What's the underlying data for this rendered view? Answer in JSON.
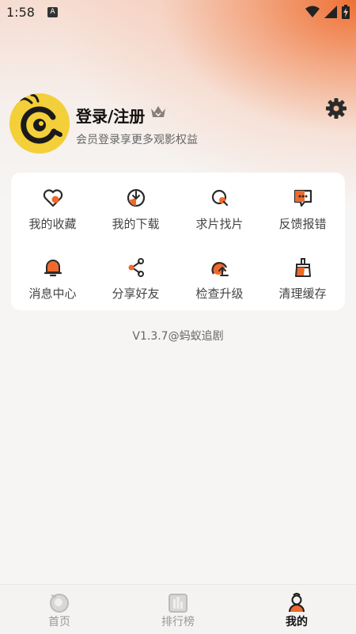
{
  "status_bar": {
    "time": "1:58",
    "notification_glyph": "A"
  },
  "profile": {
    "title": "登录/注册",
    "subtitle": "会员登录享更多观影权益"
  },
  "menu": [
    {
      "label": "我的收藏",
      "icon": "heart-icon"
    },
    {
      "label": "我的下载",
      "icon": "download-icon"
    },
    {
      "label": "求片找片",
      "icon": "search-film-icon"
    },
    {
      "label": "反馈报错",
      "icon": "feedback-icon"
    },
    {
      "label": "消息中心",
      "icon": "bell-icon"
    },
    {
      "label": "分享好友",
      "icon": "share-icon"
    },
    {
      "label": "检查升级",
      "icon": "upgrade-icon"
    },
    {
      "label": "清理缓存",
      "icon": "broom-icon"
    }
  ],
  "version": "V1.3.7@蚂蚁追剧",
  "bottom_nav": [
    {
      "label": "首页",
      "icon": "home-icon",
      "active": false
    },
    {
      "label": "排行榜",
      "icon": "ranking-icon",
      "active": false
    },
    {
      "label": "我的",
      "icon": "profile-icon",
      "active": true
    }
  ],
  "colors": {
    "accent": "#ee6a2c",
    "dark": "#222222",
    "avatar": "#f3cf3a"
  }
}
